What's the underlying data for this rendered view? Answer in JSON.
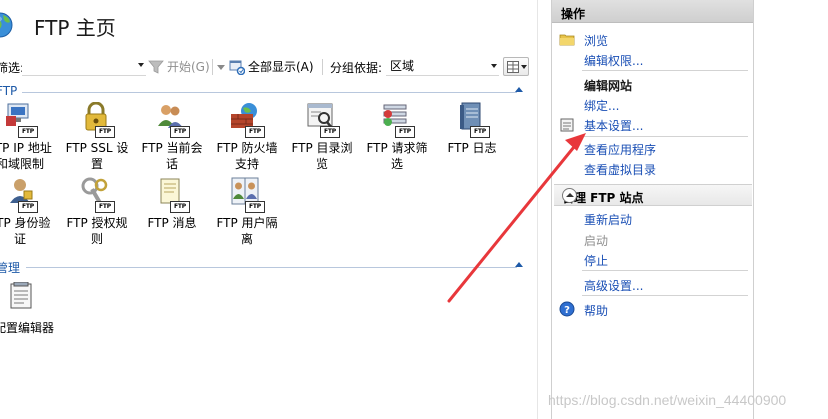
{
  "header": {
    "title": "FTP 主页"
  },
  "toolbar": {
    "filter_label": "筛选:",
    "start_label": "开始(G)",
    "show_all_label": "全部显示(A)",
    "group_by_label": "分组依据:",
    "group_by_value": "区域"
  },
  "groups": {
    "ftp": {
      "title": "FTP",
      "features": [
        {
          "line1": "FTP IP 地址",
          "line2": "和域限制"
        },
        {
          "line1": "FTP SSL 设",
          "line2": "置"
        },
        {
          "line1": "FTP 当前会",
          "line2": "话"
        },
        {
          "line1": "FTP 防火墙",
          "line2": "支持"
        },
        {
          "line1": "FTP 目录浏",
          "line2": "览"
        },
        {
          "line1": "FTP 请求筛",
          "line2": "选"
        },
        {
          "line1": "FTP 日志",
          "line2": ""
        },
        {
          "line1": "FTP 身份验",
          "line2": "证"
        },
        {
          "line1": "FTP 授权规",
          "line2": "则"
        },
        {
          "line1": "FTP 消息",
          "line2": ""
        },
        {
          "line1": "FTP 用户隔",
          "line2": "离"
        }
      ]
    },
    "manage": {
      "title": "管理",
      "features": [
        {
          "line1": "配置编辑器",
          "line2": ""
        }
      ]
    }
  },
  "icon_badge": "FTP",
  "actions": {
    "title": "操作",
    "browse": "浏览",
    "edit_permissions": "编辑权限...",
    "edit_site_heading": "编辑网站",
    "bindings": "绑定...",
    "basic_settings": "基本设置...",
    "view_applications": "查看应用程序",
    "view_virtual_dirs": "查看虚拟目录",
    "manage_ftp_section": "管理 FTP 站点",
    "restart": "重新启动",
    "start": "启动",
    "stop": "停止",
    "advanced_settings": "高级设置...",
    "help": "帮助"
  },
  "watermark": "https://blog.csdn.net/weixin_44400900",
  "colors": {
    "link": "#1a4fb5",
    "group_title": "#1e5aa8",
    "annotation_arrow": "#e8373b"
  }
}
